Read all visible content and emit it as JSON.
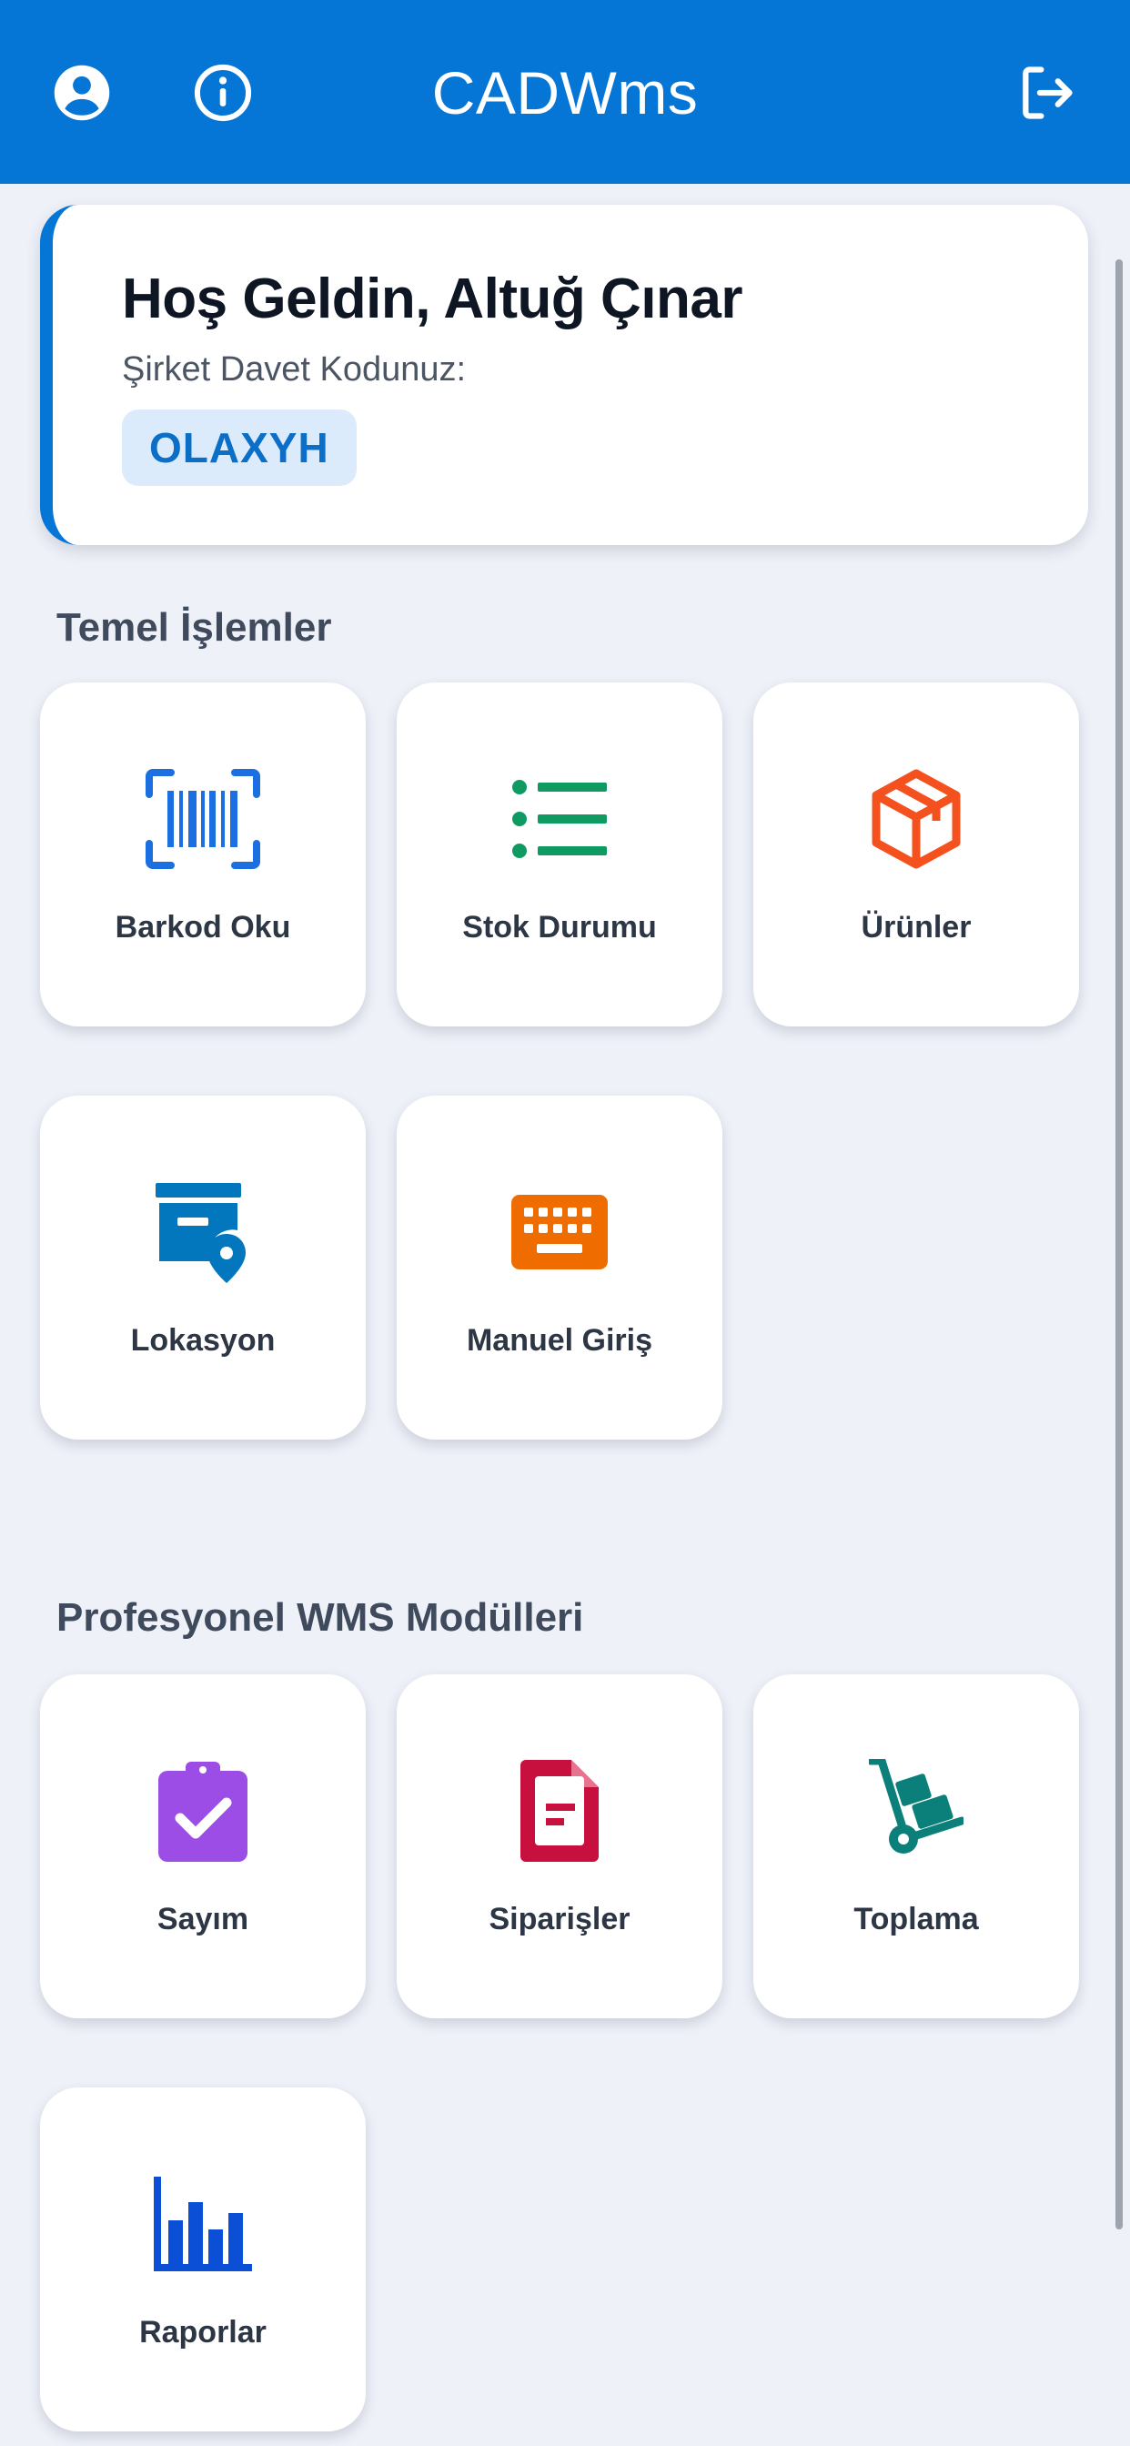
{
  "header": {
    "title": "CADWms",
    "color": "#0575d6",
    "left_icons": [
      "account-circle-icon",
      "info-circle-icon"
    ],
    "right_icon": "logout-icon"
  },
  "welcome": {
    "title": "Hoş Geldin, Altuğ Çınar",
    "subtitle": "Şirket Davet Kodunuz:",
    "invite_code": "OLAXYH"
  },
  "sections": {
    "basic": {
      "title": "Temel İşlemler",
      "items": [
        {
          "label": "Barkod Oku",
          "icon": "barcode-scan-icon",
          "color": "#1b6fe0"
        },
        {
          "label": "Stok Durumu",
          "icon": "list-icon",
          "color": "#0f9a62"
        },
        {
          "label": "Ürünler",
          "icon": "package-box-icon",
          "color": "#f4511e"
        },
        {
          "label": "Lokasyon",
          "icon": "warehouse-location-icon",
          "color": "#0277bd"
        },
        {
          "label": "Manuel Giriş",
          "icon": "keyboard-icon",
          "color": "#ef6c00"
        }
      ]
    },
    "pro": {
      "title": "Profesyonel WMS Modülleri",
      "items": [
        {
          "label": "Sayım",
          "icon": "clipboard-check-icon",
          "color": "#9b4de6"
        },
        {
          "label": "Siparişler",
          "icon": "document-icon",
          "color": "#c8103e"
        },
        {
          "label": "Toplama",
          "icon": "hand-truck-icon",
          "color": "#0b7f7a"
        },
        {
          "label": "Raporlar",
          "icon": "bar-chart-icon",
          "color": "#0b4fd6"
        }
      ]
    }
  }
}
